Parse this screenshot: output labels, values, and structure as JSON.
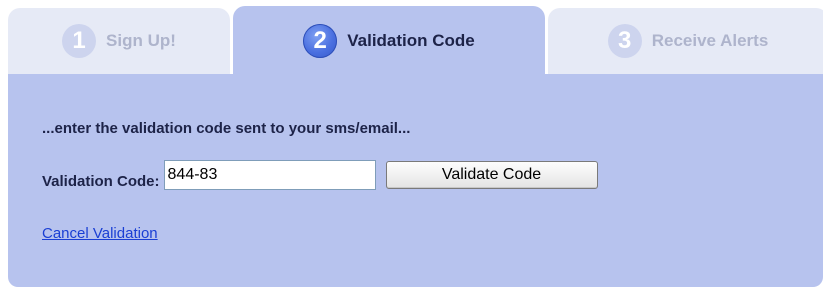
{
  "steps": [
    {
      "number": "1",
      "label": "Sign Up!",
      "state": "inactive",
      "icon": "step-1-circle-icon"
    },
    {
      "number": "2",
      "label": "Validation Code",
      "state": "active",
      "icon": "step-2-circle-icon"
    },
    {
      "number": "3",
      "label": "Receive Alerts",
      "state": "inactive",
      "icon": "step-3-circle-icon"
    }
  ],
  "panel": {
    "instruction": "...enter the validation code sent to your sms/email...",
    "code_label": "Validation Code:",
    "code_value": "844-83",
    "validate_button": "Validate Code",
    "cancel_link": "Cancel Validation"
  },
  "colors": {
    "active_tab": "#b7c3ee",
    "inactive_tab": "#e6eaf6",
    "active_step_circle": "#4a6fe0",
    "link": "#1a3fd4",
    "text_dark": "#1d2348"
  }
}
